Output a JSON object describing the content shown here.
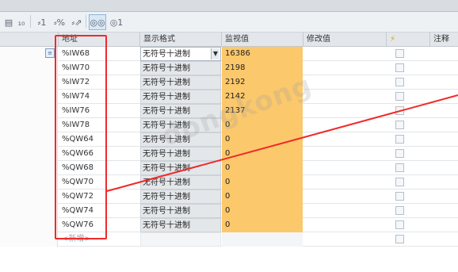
{
  "headers": {
    "address": "地址",
    "display_format": "显示格式",
    "monitor_value": "监视值",
    "modify_value": "修改值",
    "modify_flag": "⚡",
    "comment": "注释"
  },
  "rows": [
    {
      "address": "%IW68",
      "format": "无符号十进制",
      "value": "16386",
      "selected": true
    },
    {
      "address": "%IW70",
      "format": "无符号十进制",
      "value": "2198"
    },
    {
      "address": "%IW72",
      "format": "无符号十进制",
      "value": "2192"
    },
    {
      "address": "%IW74",
      "format": "无符号十进制",
      "value": "2142"
    },
    {
      "address": "%IW76",
      "format": "无符号十进制",
      "value": "2137"
    },
    {
      "address": "%IW78",
      "format": "无符号十进制",
      "value": "0"
    },
    {
      "address": "%QW64",
      "format": "无符号十进制",
      "value": "0"
    },
    {
      "address": "%QW66",
      "format": "无符号十进制",
      "value": "0"
    },
    {
      "address": "%QW68",
      "format": "无符号十进制",
      "value": "0"
    },
    {
      "address": "%QW70",
      "format": "无符号十进制",
      "value": "0"
    },
    {
      "address": "%QW72",
      "format": "无符号十进制",
      "value": "0"
    },
    {
      "address": "%QW74",
      "format": "无符号十进制",
      "value": "0"
    },
    {
      "address": "%QW76",
      "format": "无符号十进制",
      "value": "0"
    }
  ],
  "new_row_label": "<新增>",
  "watermark": "dongkong",
  "colors": {
    "monitor_bg": "#fbc86b",
    "highlight": "#ef2a2a"
  }
}
